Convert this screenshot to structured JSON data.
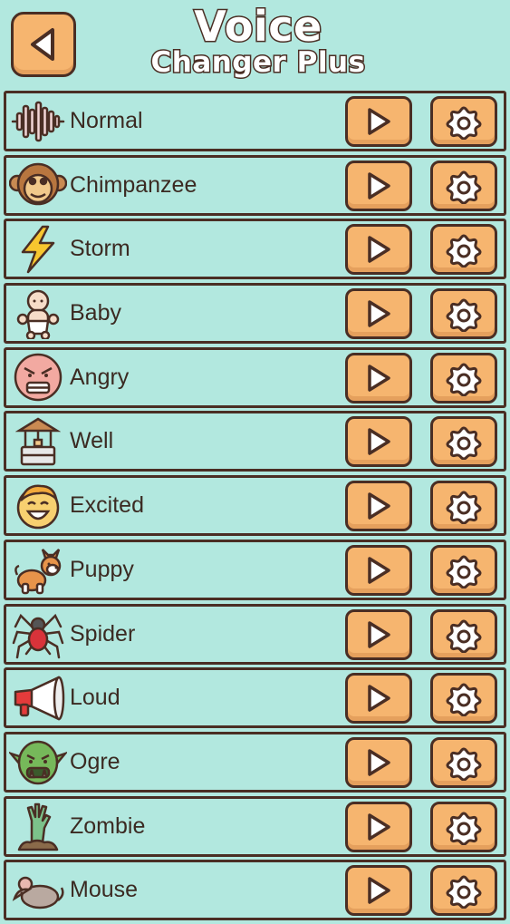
{
  "header": {
    "title_line1": "Voice",
    "title_line2": "Changer Plus",
    "back_icon": "back-arrow-icon"
  },
  "voices": [
    {
      "label": "Normal",
      "icon": "waveform-icon"
    },
    {
      "label": "Chimpanzee",
      "icon": "chimpanzee-icon"
    },
    {
      "label": "Storm",
      "icon": "lightning-icon"
    },
    {
      "label": "Baby",
      "icon": "baby-icon"
    },
    {
      "label": "Angry",
      "icon": "angry-face-icon"
    },
    {
      "label": "Well",
      "icon": "well-icon"
    },
    {
      "label": "Excited",
      "icon": "excited-face-icon"
    },
    {
      "label": "Puppy",
      "icon": "puppy-icon"
    },
    {
      "label": "Spider",
      "icon": "spider-icon"
    },
    {
      "label": "Loud",
      "icon": "megaphone-icon"
    },
    {
      "label": "Ogre",
      "icon": "ogre-icon"
    },
    {
      "label": "Zombie",
      "icon": "zombie-hand-icon"
    },
    {
      "label": "Mouse",
      "icon": "mouse-icon"
    }
  ],
  "colors": {
    "background": "#b2e8df",
    "button": "#f6b56f",
    "outline": "#4a2e24"
  }
}
